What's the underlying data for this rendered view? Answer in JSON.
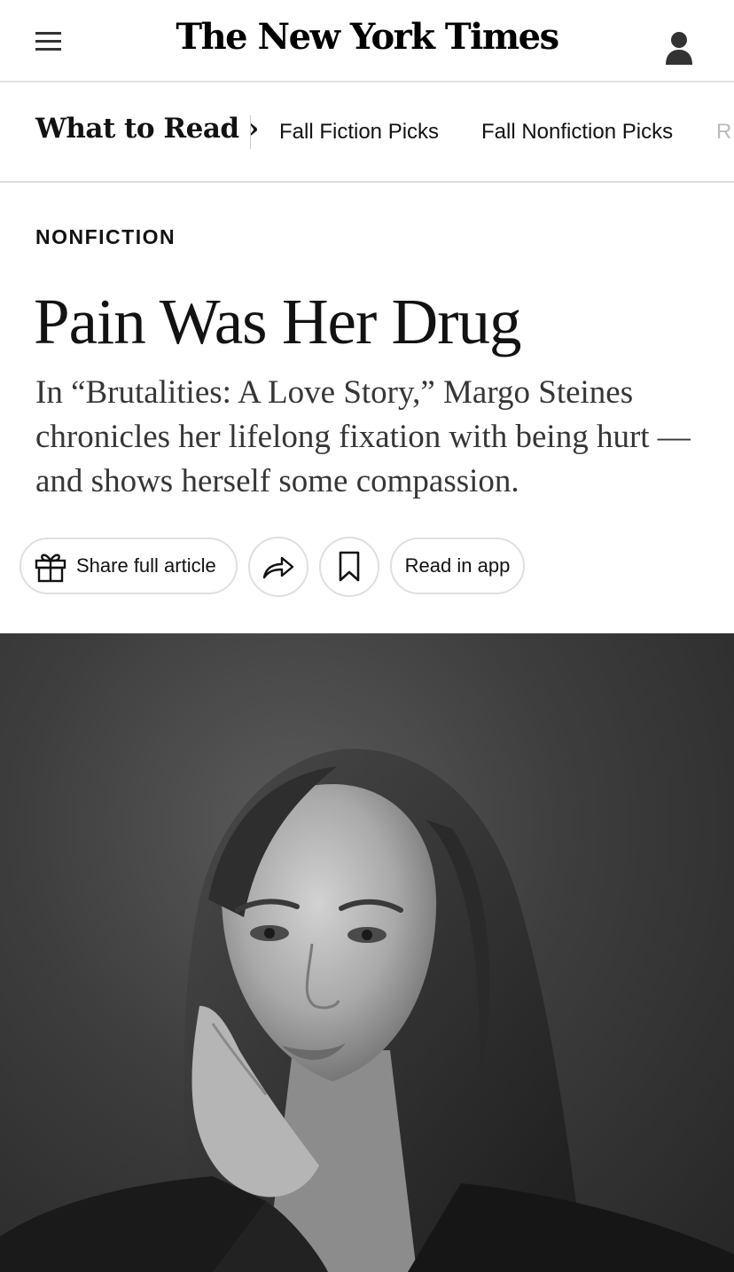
{
  "masthead": {
    "logo": "The New York Times",
    "menu_icon": "hamburger-icon",
    "user_icon": "user-icon"
  },
  "subnav": {
    "section_title": "What to Read ›",
    "links": [
      "Fall Fiction Picks",
      "Fall Nonfiction Picks",
      "R"
    ]
  },
  "article": {
    "kicker": "NONFICTION",
    "headline": "Pain Was Her Drug",
    "summary": "In “Brutalities: A Love Story,” Margo Steines chronicles her lifelong fixation with being hurt — and shows herself some compassion."
  },
  "actions": {
    "share_label": "Share full article",
    "share_icon": "gift-icon",
    "forward_icon": "share-arrow-icon",
    "save_icon": "bookmark-icon",
    "app_label": "Read in app"
  },
  "photo": {
    "subject": "portrait-photo",
    "style": "black-and-white"
  },
  "colors": {
    "text": "#121212",
    "summary": "#363636",
    "border": "#dfdfdf",
    "photo_bg": "#3d3d3d"
  }
}
